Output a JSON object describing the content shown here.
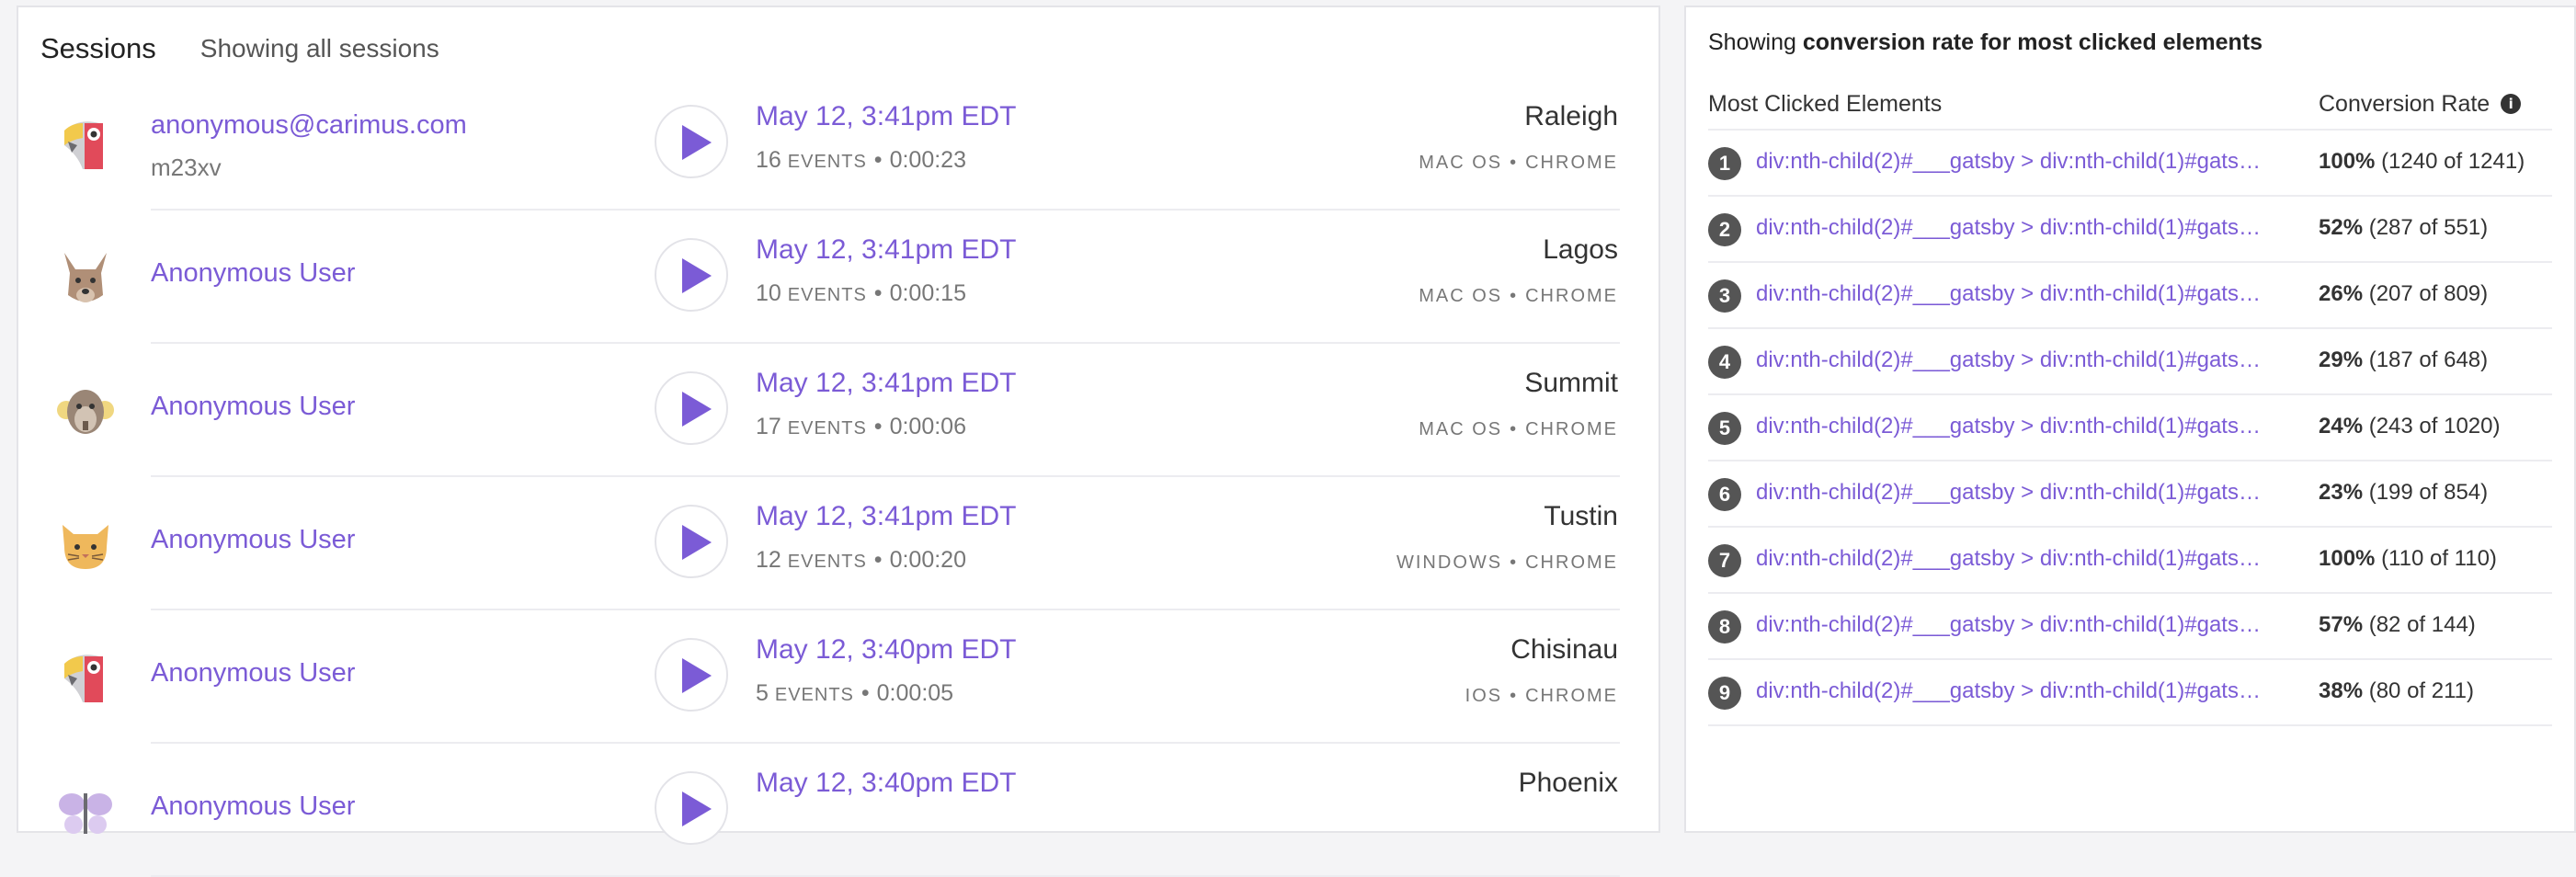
{
  "sessions": {
    "title": "Sessions",
    "subtitle": "Showing all sessions",
    "rows": [
      {
        "name": "anonymous@carimus.com",
        "sub": "m23xv",
        "avatar": "parrot",
        "date": "May 12, 3:41pm EDT",
        "events": "16",
        "events_label": "EVENTS",
        "duration": "0:00:23",
        "city": "Raleigh",
        "os": "MAC OS",
        "browser": "CHROME"
      },
      {
        "name": "Anonymous User",
        "sub": "",
        "avatar": "kangaroo",
        "date": "May 12, 3:41pm EDT",
        "events": "10",
        "events_label": "EVENTS",
        "duration": "0:00:15",
        "city": "Lagos",
        "os": "MAC OS",
        "browser": "CHROME"
      },
      {
        "name": "Anonymous User",
        "sub": "",
        "avatar": "monkey",
        "date": "May 12, 3:41pm EDT",
        "events": "17",
        "events_label": "EVENTS",
        "duration": "0:00:06",
        "city": "Summit",
        "os": "MAC OS",
        "browser": "CHROME"
      },
      {
        "name": "Anonymous User",
        "sub": "",
        "avatar": "cat",
        "date": "May 12, 3:41pm EDT",
        "events": "12",
        "events_label": "EVENTS",
        "duration": "0:00:20",
        "city": "Tustin",
        "os": "WINDOWS",
        "browser": "CHROME"
      },
      {
        "name": "Anonymous User",
        "sub": "",
        "avatar": "parrot",
        "date": "May 12, 3:40pm EDT",
        "events": "5",
        "events_label": "EVENTS",
        "duration": "0:00:05",
        "city": "Chisinau",
        "os": "IOS",
        "browser": "CHROME"
      },
      {
        "name": "Anonymous User",
        "sub": "",
        "avatar": "butterfly",
        "date": "May 12, 3:40pm EDT",
        "events": "",
        "events_label": "",
        "duration": "",
        "city": "Phoenix",
        "os": "",
        "browser": ""
      }
    ]
  },
  "conversion": {
    "showing_prefix": "Showing",
    "showing_bold": "conversion rate for most clicked elements",
    "col_elements": "Most Clicked Elements",
    "col_rate": "Conversion Rate",
    "info_icon": "i",
    "items": [
      {
        "rank": "1",
        "selector": "div:nth-child(2)#___gatsby > div:nth-child(1)#gatsby-focus-wrapper",
        "pct": "100%",
        "detail": "(1240 of 1241)"
      },
      {
        "rank": "2",
        "selector": "div:nth-child(2)#___gatsby > div:nth-child(1)#gatsby-focus-wrapper",
        "pct": "52%",
        "detail": "(287 of 551)"
      },
      {
        "rank": "3",
        "selector": "div:nth-child(2)#___gatsby > div:nth-child(1)#gatsby-focus-wrapper",
        "pct": "26%",
        "detail": "(207 of 809)"
      },
      {
        "rank": "4",
        "selector": "div:nth-child(2)#___gatsby > div:nth-child(1)#gatsby-focus-wrapper",
        "pct": "29%",
        "detail": "(187 of 648)"
      },
      {
        "rank": "5",
        "selector": "div:nth-child(2)#___gatsby > div:nth-child(1)#gatsby-focus-wrapper",
        "pct": "24%",
        "detail": "(243 of 1020)"
      },
      {
        "rank": "6",
        "selector": "div:nth-child(2)#___gatsby > div:nth-child(1)#gatsby-focus-wrapper",
        "pct": "23%",
        "detail": "(199 of 854)"
      },
      {
        "rank": "7",
        "selector": "div:nth-child(2)#___gatsby > div:nth-child(1)#gatsby-focus-wrapper",
        "pct": "100%",
        "detail": "(110 of 110)"
      },
      {
        "rank": "8",
        "selector": "div:nth-child(2)#___gatsby > div:nth-child(1)#gatsby-focus-wrapper",
        "pct": "57%",
        "detail": "(82 of 144)"
      },
      {
        "rank": "9",
        "selector": "div:nth-child(2)#___gatsby > div:nth-child(1)#gatsby-focus-wrapper",
        "pct": "38%",
        "detail": "(80 of 211)"
      }
    ]
  },
  "colors": {
    "accent": "#7b5bd6",
    "rank_badge": "#555555"
  }
}
